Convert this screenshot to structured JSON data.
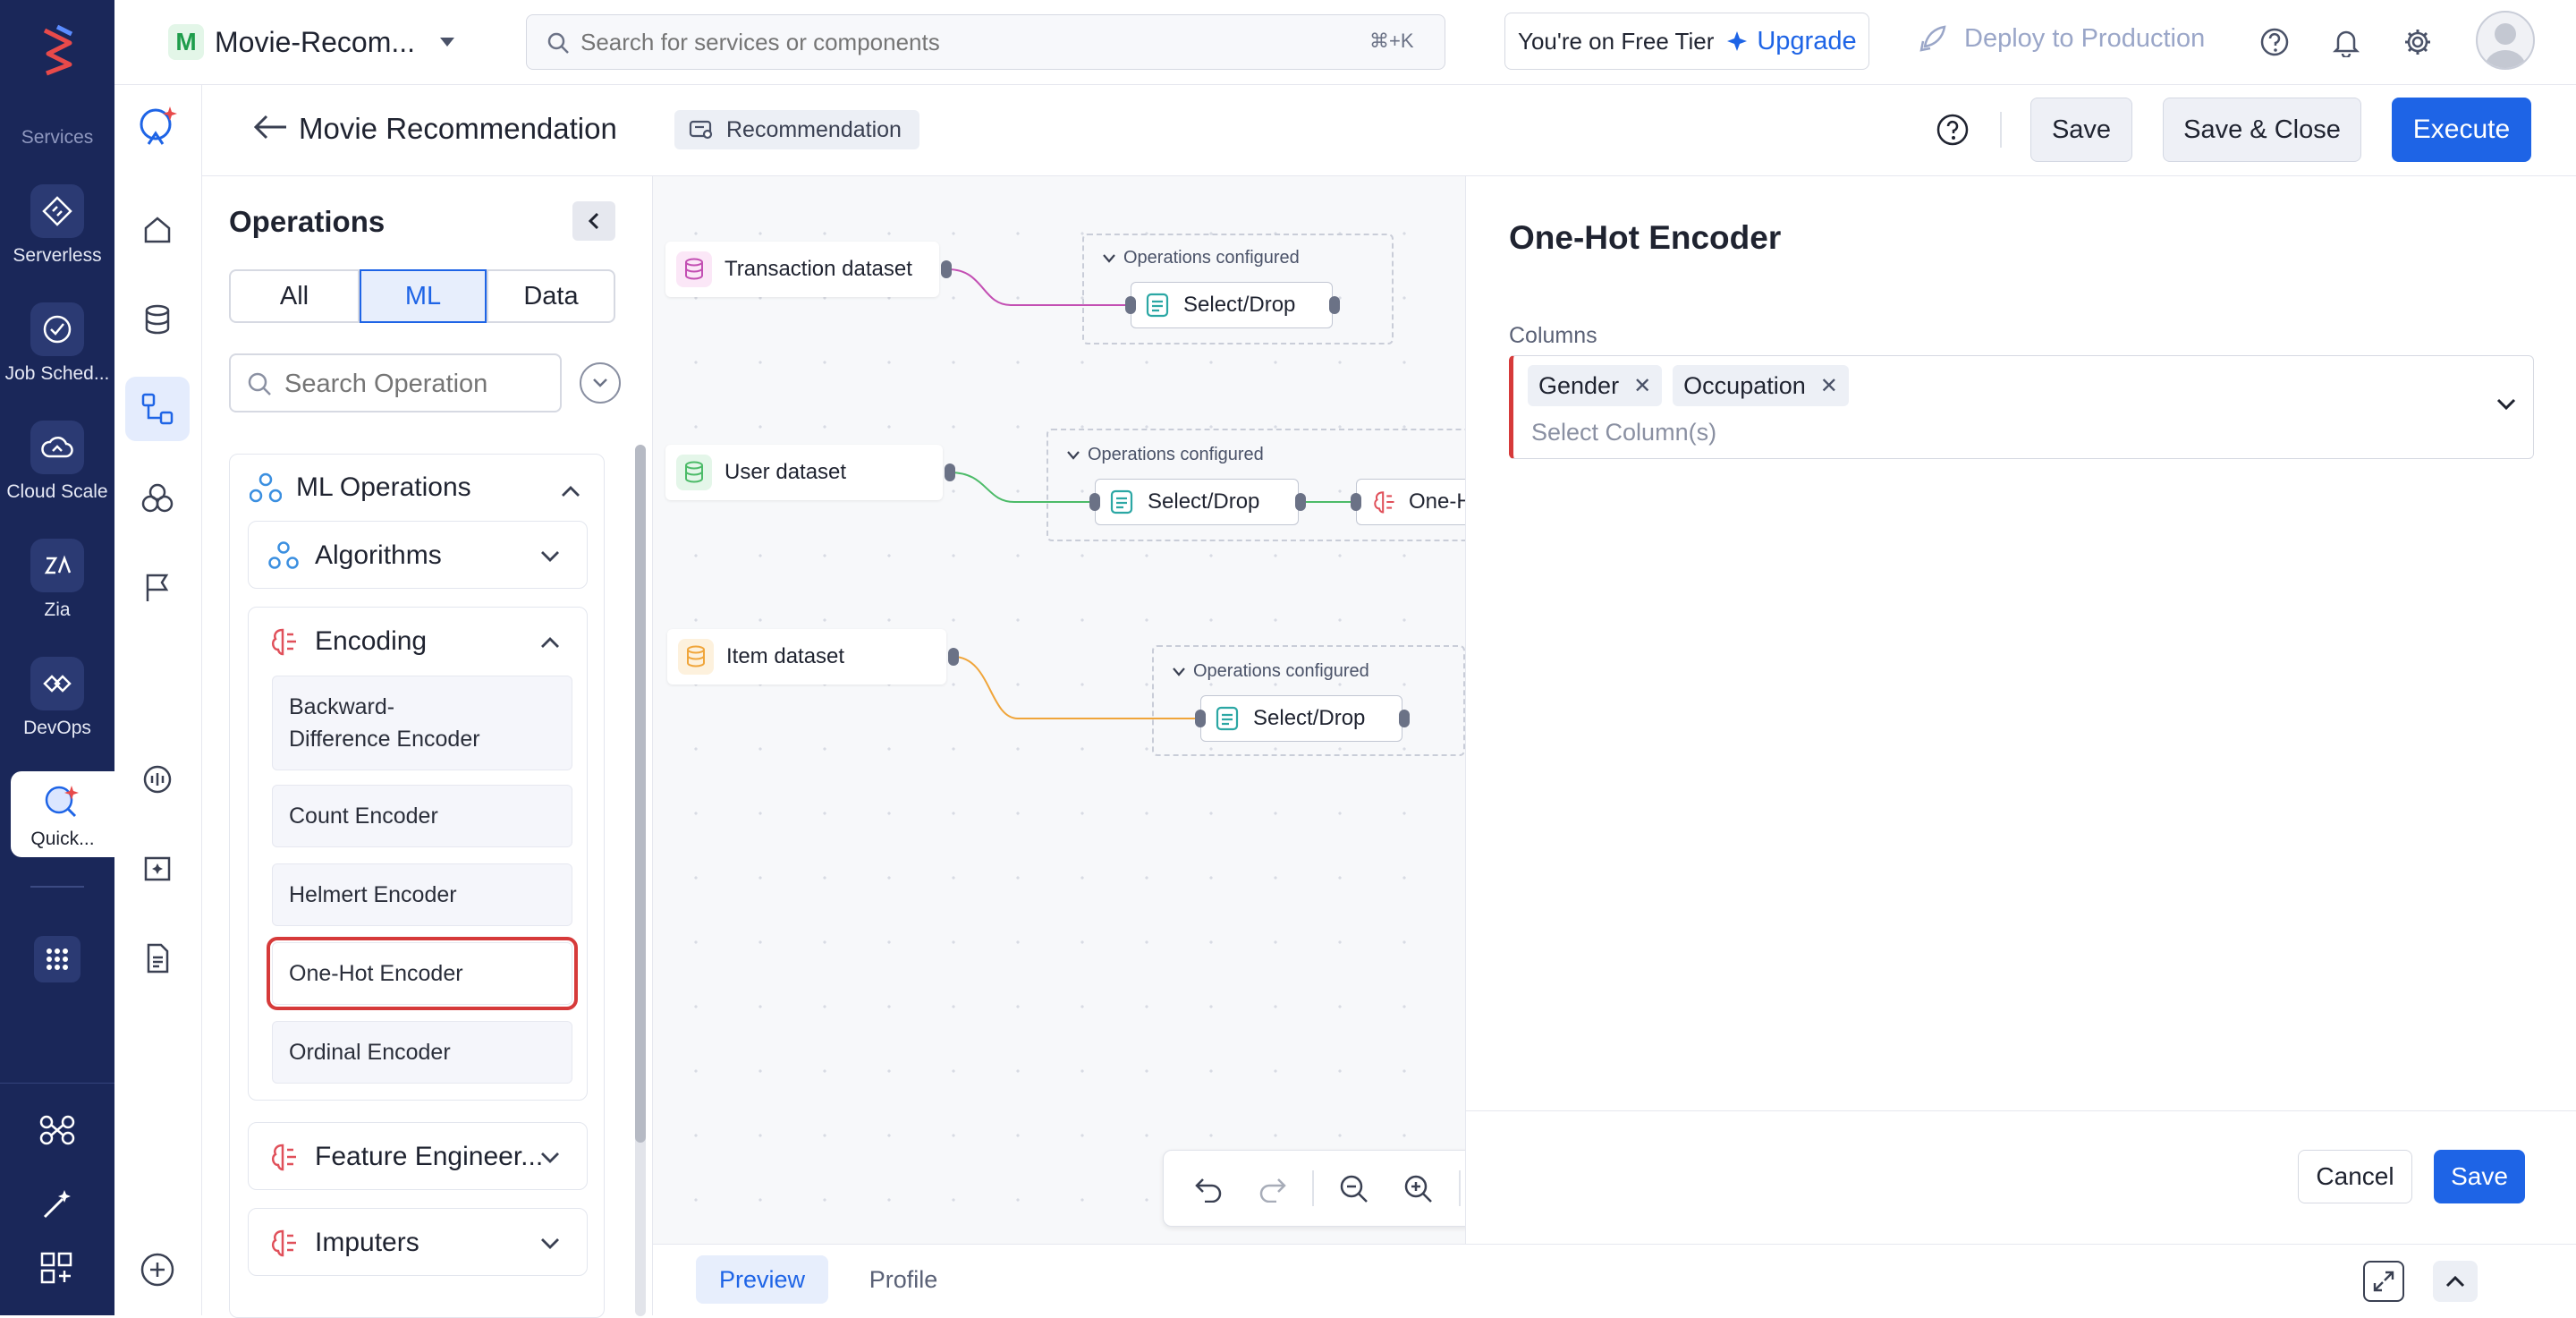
{
  "app": {
    "project_initial": "M",
    "project_name": "Movie-Recom...",
    "search_placeholder": "Search for services or components",
    "search_shortcut": "⌘+K",
    "tier_text": "You're on Free Tier",
    "upgrade_label": "Upgrade",
    "deploy_label": "Deploy to Production"
  },
  "rail": {
    "section_label": "Services",
    "items": [
      {
        "label": "Serverless",
        "icon": "serverless-icon"
      },
      {
        "label": "Job Sched...",
        "icon": "job-scheduler-icon"
      },
      {
        "label": "Cloud Scale",
        "icon": "cloud-scale-icon"
      },
      {
        "label": "Zia",
        "icon": "zia-icon"
      },
      {
        "label": "DevOps",
        "icon": "devops-icon"
      },
      {
        "label": "Quick...",
        "icon": "quickml-icon"
      }
    ]
  },
  "header": {
    "title": "Movie Recommendation",
    "tag": "Recommendation",
    "save_label": "Save",
    "save_close_label": "Save & Close",
    "execute_label": "Execute"
  },
  "operations": {
    "title": "Operations",
    "tabs": [
      "All",
      "ML",
      "Data"
    ],
    "active_tab": "ML",
    "search_placeholder": "Search Operation",
    "ml_section": "ML Operations",
    "algorithms": "Algorithms",
    "encoding": "Encoding",
    "encoders": [
      "Backward-\nDifference Encoder",
      "Count Encoder",
      "Helmert Encoder",
      "One-Hot Encoder",
      "Ordinal Encoder"
    ],
    "feature_engineering": "Feature Engineer...",
    "imputers": "Imputers"
  },
  "canvas": {
    "datasets": [
      "Transaction dataset",
      "User dataset",
      "Item dataset"
    ],
    "group_label": "Operations configured",
    "op_select": "Select/Drop",
    "op_onehot": "One-H"
  },
  "panel": {
    "title": "One-Hot Encoder",
    "columns_label": "Columns",
    "chips": [
      "Gender",
      "Occupation"
    ],
    "select_placeholder": "Select Column(s)",
    "cancel_label": "Cancel",
    "save_label": "Save"
  },
  "bottom": {
    "tabs": [
      "Preview",
      "Profile"
    ],
    "active_tab": "Preview"
  },
  "colors": {
    "rail_bg": "#1a2759",
    "primary": "#1e64e6",
    "transaction": "#c34fb3",
    "user": "#4cbb68",
    "item": "#f0a53a",
    "highlight": "#d63a3a"
  }
}
